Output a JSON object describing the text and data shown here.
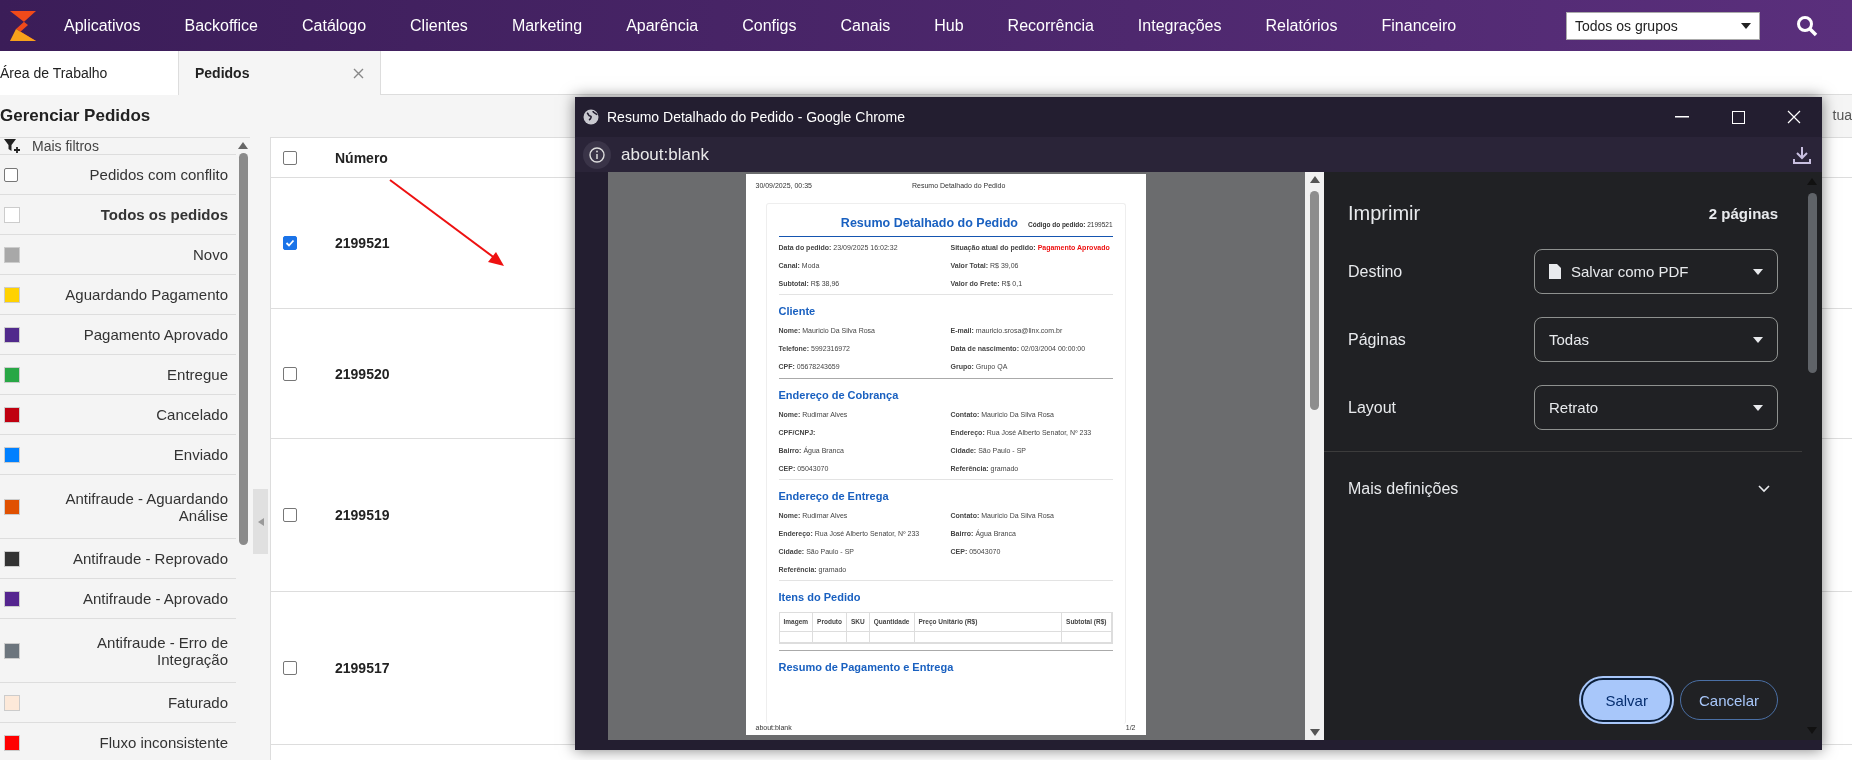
{
  "nav": {
    "items": [
      "Aplicativos",
      "Backoffice",
      "Catálogo",
      "Clientes",
      "Marketing",
      "Aparência",
      "Configs",
      "Canais",
      "Hub",
      "Recorrência",
      "Integrações",
      "Relatórios",
      "Financeiro"
    ],
    "group_select": "Todos os grupos"
  },
  "tabs": [
    {
      "label": "Área de Trabalho",
      "selected": false,
      "closable": false
    },
    {
      "label": "Pedidos",
      "selected": true,
      "closable": true
    }
  ],
  "page_title": "Gerenciar Pedidos",
  "clipped_text": "tua",
  "filters": {
    "header": "Mais filtros",
    "items": [
      {
        "kind": "checkbox",
        "label": "Pedidos com conflito",
        "checked": false,
        "selected": false
      },
      {
        "kind": "swatch",
        "label": "Todos os pedidos",
        "color": "#ffffff",
        "selected": true
      },
      {
        "kind": "swatch",
        "label": "Novo",
        "color": "#a8a8a8",
        "selected": false
      },
      {
        "kind": "swatch",
        "label": "Aguardando Pagamento",
        "color": "#ffd200",
        "selected": false
      },
      {
        "kind": "swatch",
        "label": "Pagamento Aprovado",
        "color": "#512a8c",
        "selected": false
      },
      {
        "kind": "swatch",
        "label": "Entregue",
        "color": "#28a745",
        "selected": false
      },
      {
        "kind": "swatch",
        "label": "Cancelado",
        "color": "#c00010",
        "selected": false
      },
      {
        "kind": "swatch",
        "label": "Enviado",
        "color": "#0080ff",
        "selected": false
      },
      {
        "kind": "swatch",
        "label": "Antifraude - Aguardando Análise",
        "color": "#e05000",
        "selected": false
      },
      {
        "kind": "swatch",
        "label": "Antifraude - Reprovado",
        "color": "#333333",
        "selected": false
      },
      {
        "kind": "swatch",
        "label": "Antifraude - Aprovado",
        "color": "#55258f",
        "selected": false
      },
      {
        "kind": "swatch",
        "label": "Antifraude - Erro de Integração",
        "color": "#6c757d",
        "selected": false
      },
      {
        "kind": "swatch",
        "label": "Faturado",
        "color": "#fde9d9",
        "selected": false
      },
      {
        "kind": "swatch",
        "label": "Fluxo inconsistente",
        "color": "#ff0000",
        "selected": false
      }
    ]
  },
  "orders": {
    "columns": [
      "Número"
    ],
    "header_checked": false,
    "rows": [
      {
        "number": "2199521",
        "checked": true
      },
      {
        "number": "2199520",
        "checked": false
      },
      {
        "number": "2199519",
        "checked": false
      },
      {
        "number": "2199517",
        "checked": false
      }
    ]
  },
  "print_window": {
    "title": "Resumo Detalhado do Pedido - Google Chrome",
    "address": "about:blank",
    "preview": {
      "header_date": "30/09/2025, 00:35",
      "header_title": "Resumo Detalhado do Pedido",
      "footer_url": "about:blank",
      "footer_page": "1/2",
      "doc_title": "Resumo Detalhado do Pedido",
      "code": {
        "label": "Código do pedido:",
        "value": "2199521"
      },
      "sections": [
        {
          "fields": [
            {
              "label": "Data do pedido:",
              "value": "23/09/2025 16:02:32",
              "emphasis": false
            },
            {
              "label": "Situação atual do pedido:",
              "value": "Pagamento Aprovado",
              "emphasis": true
            },
            {
              "label": "Canal:",
              "value": "Moda",
              "emphasis": false
            },
            {
              "label": "Valor Total:",
              "value": "R$ 39,06",
              "emphasis": false
            },
            {
              "label": "Subtotal:",
              "value": "R$ 38,96",
              "emphasis": false
            },
            {
              "label": "Valor do Frete:",
              "value": "R$ 0,1",
              "emphasis": false
            }
          ]
        },
        {
          "heading": "Cliente",
          "fields": [
            {
              "label": "Nome:",
              "value": "Mauricio Da Silva Rosa",
              "emphasis": false
            },
            {
              "label": "E-mail:",
              "value": "mauricio.srosa@linx.com.br",
              "emphasis": false
            },
            {
              "label": "Telefone:",
              "value": "5992316972",
              "emphasis": false
            },
            {
              "label": "Data de nascimento:",
              "value": "02/03/2004 00:00:00",
              "emphasis": false
            },
            {
              "label": "CPF:",
              "value": "05678243659",
              "emphasis": false
            },
            {
              "label": "Grupo:",
              "value": "Grupo QA",
              "emphasis": false
            }
          ]
        },
        {
          "heading": "Endereço de Cobrança",
          "fields": [
            {
              "label": "Nome:",
              "value": "Rudimar Alves",
              "emphasis": false
            },
            {
              "label": "Contato:",
              "value": "Mauricio Da Silva Rosa",
              "emphasis": false
            },
            {
              "label": "CPF/CNPJ:"
            },
            {
              "label": "Endereço:",
              "value": "Rua José Alberto Senator, Nº 233",
              "emphasis": false
            },
            {
              "label": "Bairro:",
              "value": "Água Branca",
              "emphasis": false
            },
            {
              "label": "Cidade:",
              "value": "São Paulo - SP",
              "emphasis": false
            },
            {
              "label": "CEP:",
              "value": "05043070",
              "emphasis": false
            },
            {
              "label": "Referência:",
              "value": "gramado",
              "emphasis": false
            }
          ]
        },
        {
          "heading": "Endereço de Entrega",
          "fields": [
            {
              "label": "Nome:",
              "value": "Rudimar Alves",
              "emphasis": false
            },
            {
              "label": "Contato:",
              "value": "Mauricio Da Silva Rosa",
              "emphasis": false
            },
            {
              "label": "Endereço:",
              "value": "Rua José Alberto Senator, Nº 233",
              "emphasis": false
            },
            {
              "label": "Bairro:",
              "value": "Água Branca",
              "emphasis": false
            },
            {
              "label": "Cidade:",
              "value": "São Paulo - SP",
              "emphasis": false
            },
            {
              "label": "CEP:",
              "value": "05043070",
              "emphasis": false
            },
            {
              "label": "Referência:",
              "value": "gramado",
              "emphasis": false
            }
          ]
        }
      ],
      "items_heading": "Itens do Pedido",
      "items_columns": [
        "Imagem",
        "Produto",
        "SKU",
        "Quantidade",
        "Preço Unitário (R$)",
        "Subtotal (R$)"
      ],
      "last_heading": "Resumo de Pagamento e Entrega"
    },
    "settings": {
      "title": "Imprimir",
      "pages_count": "2 páginas",
      "options": [
        {
          "label": "Destino",
          "value": "Salvar como PDF",
          "kind": "destination"
        },
        {
          "label": "Páginas",
          "value": "Todas",
          "kind": "select"
        },
        {
          "label": "Layout",
          "value": "Retrato",
          "kind": "select"
        }
      ],
      "more": "Mais definições",
      "expanded": false,
      "buttons": [
        {
          "label": "Salvar",
          "kind": "primary"
        },
        {
          "label": "Cancelar",
          "kind": "secondary"
        }
      ]
    }
  }
}
